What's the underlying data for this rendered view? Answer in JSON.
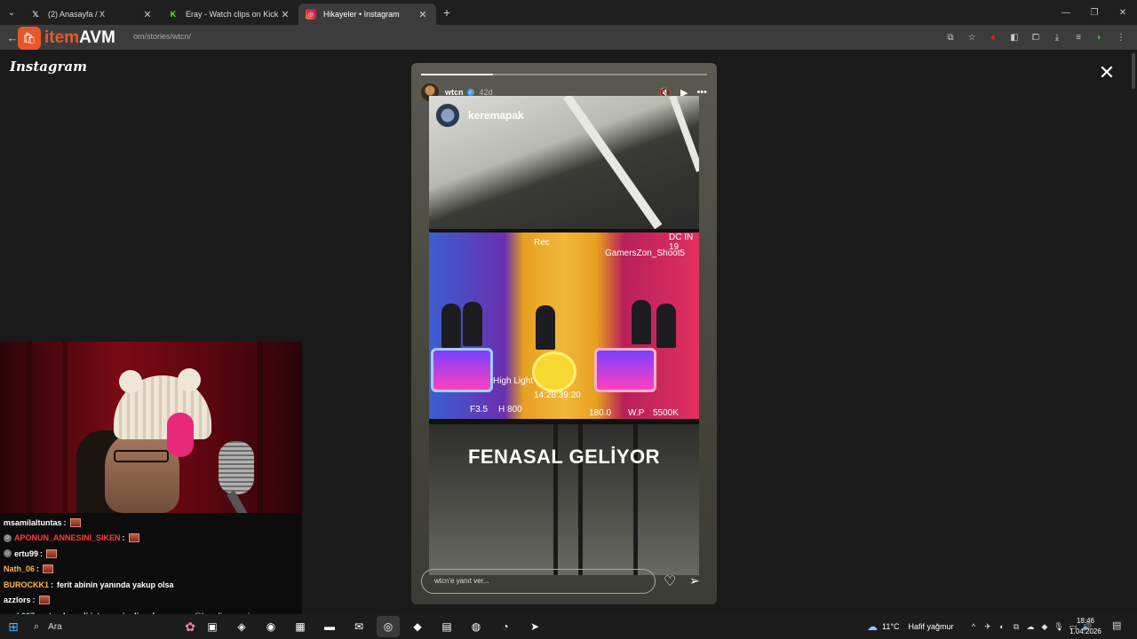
{
  "browser": {
    "tabs": [
      {
        "favicon": "x-icon",
        "title": "(2) Anasayfa / X",
        "close": "✕"
      },
      {
        "favicon": "kick-icon",
        "title": "Eray - Watch clips on Kick",
        "close": "✕"
      },
      {
        "favicon": "instagram-icon",
        "title": "Hikayeler • Instagram",
        "close": "✕"
      }
    ],
    "new_tab": "+",
    "url_visible": "om/stories/wtcn/",
    "overlay_logo": {
      "part1": "item",
      "part2": "AVM"
    }
  },
  "instagram": {
    "logo": "Instagram",
    "close": "✕"
  },
  "story": {
    "progress_fraction": 0.25,
    "username": "wtcn",
    "age": "42d",
    "mention": "keremapak",
    "video_overlays": {
      "rec": "Rec",
      "cam": "GamersZon_Shoot5",
      "dc": "DC IN 19",
      "hl": "High Light",
      "tc": "14:28:39:20",
      "f": "F3.5",
      "h": "H 800",
      "e": "180.0",
      "w": "W.P",
      "k": "5500K"
    },
    "caption": "FENASAL GELİYOR",
    "reply_placeholder": "wtcn'e yanıt ver..."
  },
  "chat": [
    {
      "user": "msamilaltuntas",
      "color": "#ffffff",
      "badge": false,
      "text": "",
      "emote": true
    },
    {
      "user": "APONUN_ANNESINI_SIKEN",
      "color": "#ff3b3b",
      "badge": true,
      "text": "",
      "emote": true
    },
    {
      "user": "ertu99",
      "color": "#ffffff",
      "badge": true,
      "text": "",
      "emote": true
    },
    {
      "user": "Nath_06",
      "color": "#ffb84d",
      "badge": false,
      "text": "",
      "emote": true
    },
    {
      "user": "BUROCKK1",
      "color": "#ffb84d",
      "badge": false,
      "text": "ferit abinin yanında yakup olsa",
      "emote": false
    },
    {
      "user": "azzlors",
      "color": "#ffffff",
      "badge": false,
      "text": "",
      "emote": true
    },
    {
      "user": "saek007",
      "color": "#7fff7f",
      "badge": false,
      "text": "wtcn kemali istememiş diye duyum var",
      "emote": false,
      "mention": "@kendinemuzisyen"
    }
  ],
  "taskbar": {
    "search_label": "Ara",
    "weather_temp": "11°C",
    "weather_desc": "Hafif yağmur",
    "time": "18:46",
    "date": "1.04.2026"
  }
}
